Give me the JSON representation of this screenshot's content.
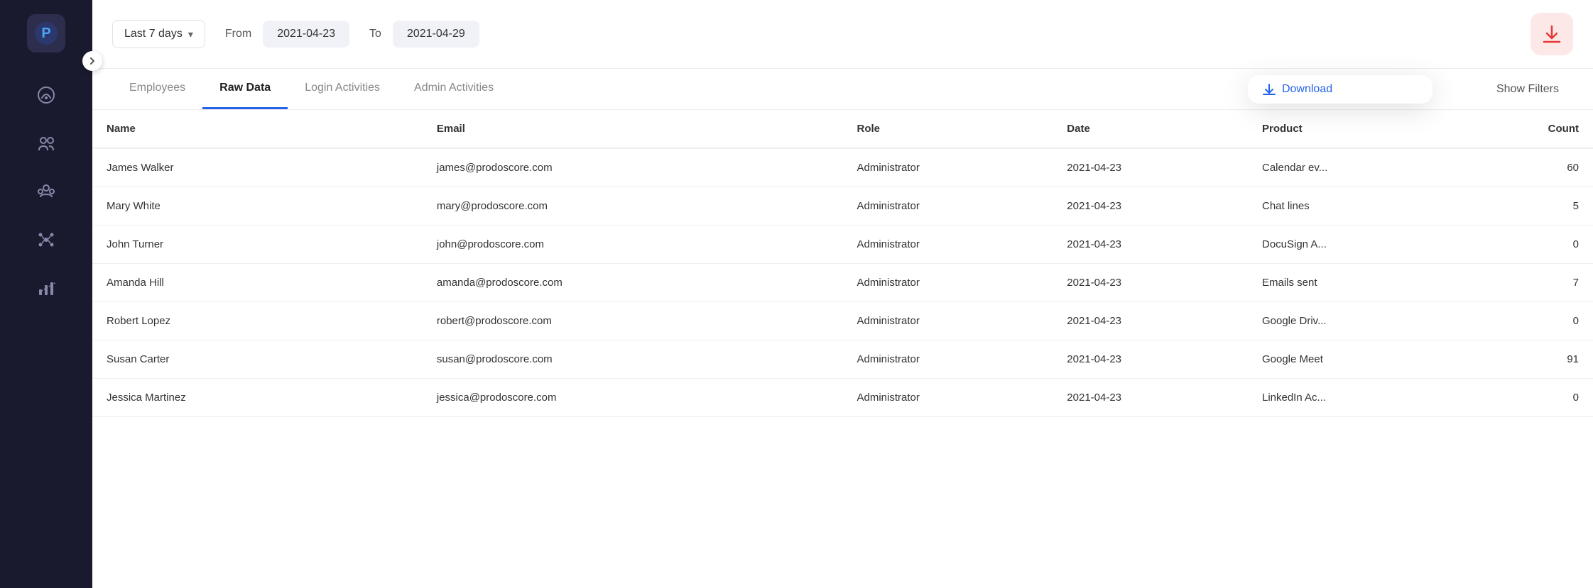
{
  "sidebar": {
    "logo_text": "P",
    "toggle_icon": "chevron-right",
    "items": [
      {
        "id": "dashboard",
        "icon": "gauge",
        "active": false
      },
      {
        "id": "employees",
        "icon": "people",
        "active": false
      },
      {
        "id": "teams",
        "icon": "group",
        "active": false
      },
      {
        "id": "network",
        "icon": "network",
        "active": false
      },
      {
        "id": "reports",
        "icon": "chart",
        "active": false
      }
    ]
  },
  "topbar": {
    "date_range_label": "Last 7 days",
    "from_label": "From",
    "from_date": "2021-04-23",
    "to_label": "To",
    "to_date": "2021-04-29",
    "download_icon": "download"
  },
  "tabs": [
    {
      "id": "employees",
      "label": "Employees",
      "active": false
    },
    {
      "id": "raw-data",
      "label": "Raw Data",
      "active": true
    },
    {
      "id": "login-activities",
      "label": "Login Activities",
      "active": false
    },
    {
      "id": "admin-activities",
      "label": "Admin Activities",
      "active": false
    }
  ],
  "toolbar": {
    "download_label": "Download",
    "show_filters_label": "Show Filters"
  },
  "table": {
    "headers": [
      {
        "id": "name",
        "label": "Name"
      },
      {
        "id": "email",
        "label": "Email"
      },
      {
        "id": "role",
        "label": "Role"
      },
      {
        "id": "date",
        "label": "Date"
      },
      {
        "id": "product",
        "label": "Product"
      },
      {
        "id": "count",
        "label": "Count",
        "align": "right"
      }
    ],
    "rows": [
      {
        "name": "James Walker",
        "email": "james@prodoscore.com",
        "role": "Administrator",
        "date": "2021-04-23",
        "product": "Calendar ev...",
        "count": "60"
      },
      {
        "name": "Mary White",
        "email": "mary@prodoscore.com",
        "role": "Administrator",
        "date": "2021-04-23",
        "product": "Chat lines",
        "count": "5"
      },
      {
        "name": "John Turner",
        "email": "john@prodoscore.com",
        "role": "Administrator",
        "date": "2021-04-23",
        "product": "DocuSign A...",
        "count": "0"
      },
      {
        "name": "Amanda Hill",
        "email": "amanda@prodoscore.com",
        "role": "Administrator",
        "date": "2021-04-23",
        "product": "Emails sent",
        "count": "7"
      },
      {
        "name": "Robert Lopez",
        "email": "robert@prodoscore.com",
        "role": "Administrator",
        "date": "2021-04-23",
        "product": "Google Driv...",
        "count": "0"
      },
      {
        "name": "Susan Carter",
        "email": "susan@prodoscore.com",
        "role": "Administrator",
        "date": "2021-04-23",
        "product": "Google Meet",
        "count": "91"
      },
      {
        "name": "Jessica Martinez",
        "email": "jessica@prodoscore.com",
        "role": "Administrator",
        "date": "2021-04-23",
        "product": "LinkedIn Ac...",
        "count": "0"
      }
    ]
  }
}
